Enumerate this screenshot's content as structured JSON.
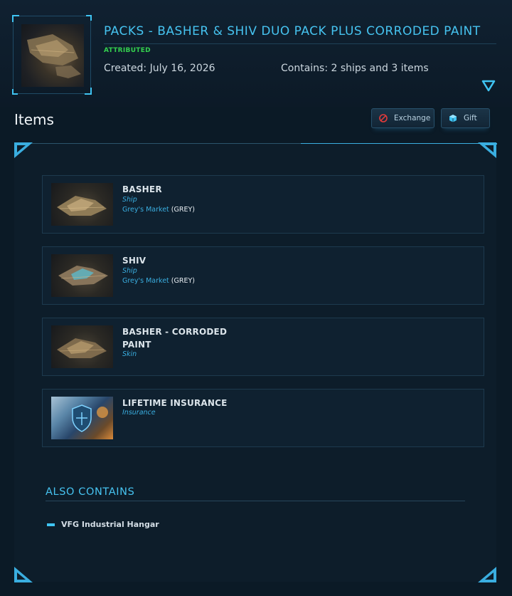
{
  "header": {
    "title": "PACKS - BASHER & SHIV DUO PACK PLUS CORRODED PAINT",
    "status_badge": "ATTRIBUTED",
    "created": "Created: July 16, 2026",
    "contains": "Contains: 2 ships and 3 items",
    "expand_icon": "triangle-down-icon"
  },
  "items_section": {
    "heading": "Items",
    "buttons": [
      {
        "label": "Exchange",
        "icon": "no-entry-icon"
      },
      {
        "label": "Gift",
        "icon": "gift-box-icon"
      }
    ]
  },
  "items": [
    {
      "name": "BASHER",
      "type": "Ship",
      "market": "Grey's Market",
      "grade": "(GREY)",
      "thumb": "ship"
    },
    {
      "name": "SHIV",
      "type": "Ship",
      "market": "Grey's Market",
      "grade": "(GREY)",
      "thumb": "ship"
    },
    {
      "name": "BASHER - CORRODED PAINT",
      "type": "Skin",
      "market": "",
      "grade": "",
      "thumb": "ship"
    },
    {
      "name": "LIFETIME INSURANCE",
      "type": "Insurance",
      "market": "",
      "grade": "",
      "thumb": "insurance"
    }
  ],
  "also_contains": {
    "heading": "ALSO CONTAINS",
    "items": [
      "VFG Industrial Hangar"
    ]
  },
  "colors": {
    "accent": "#46c3f0",
    "attributed": "#34d14e",
    "background": "#0b1a26"
  }
}
